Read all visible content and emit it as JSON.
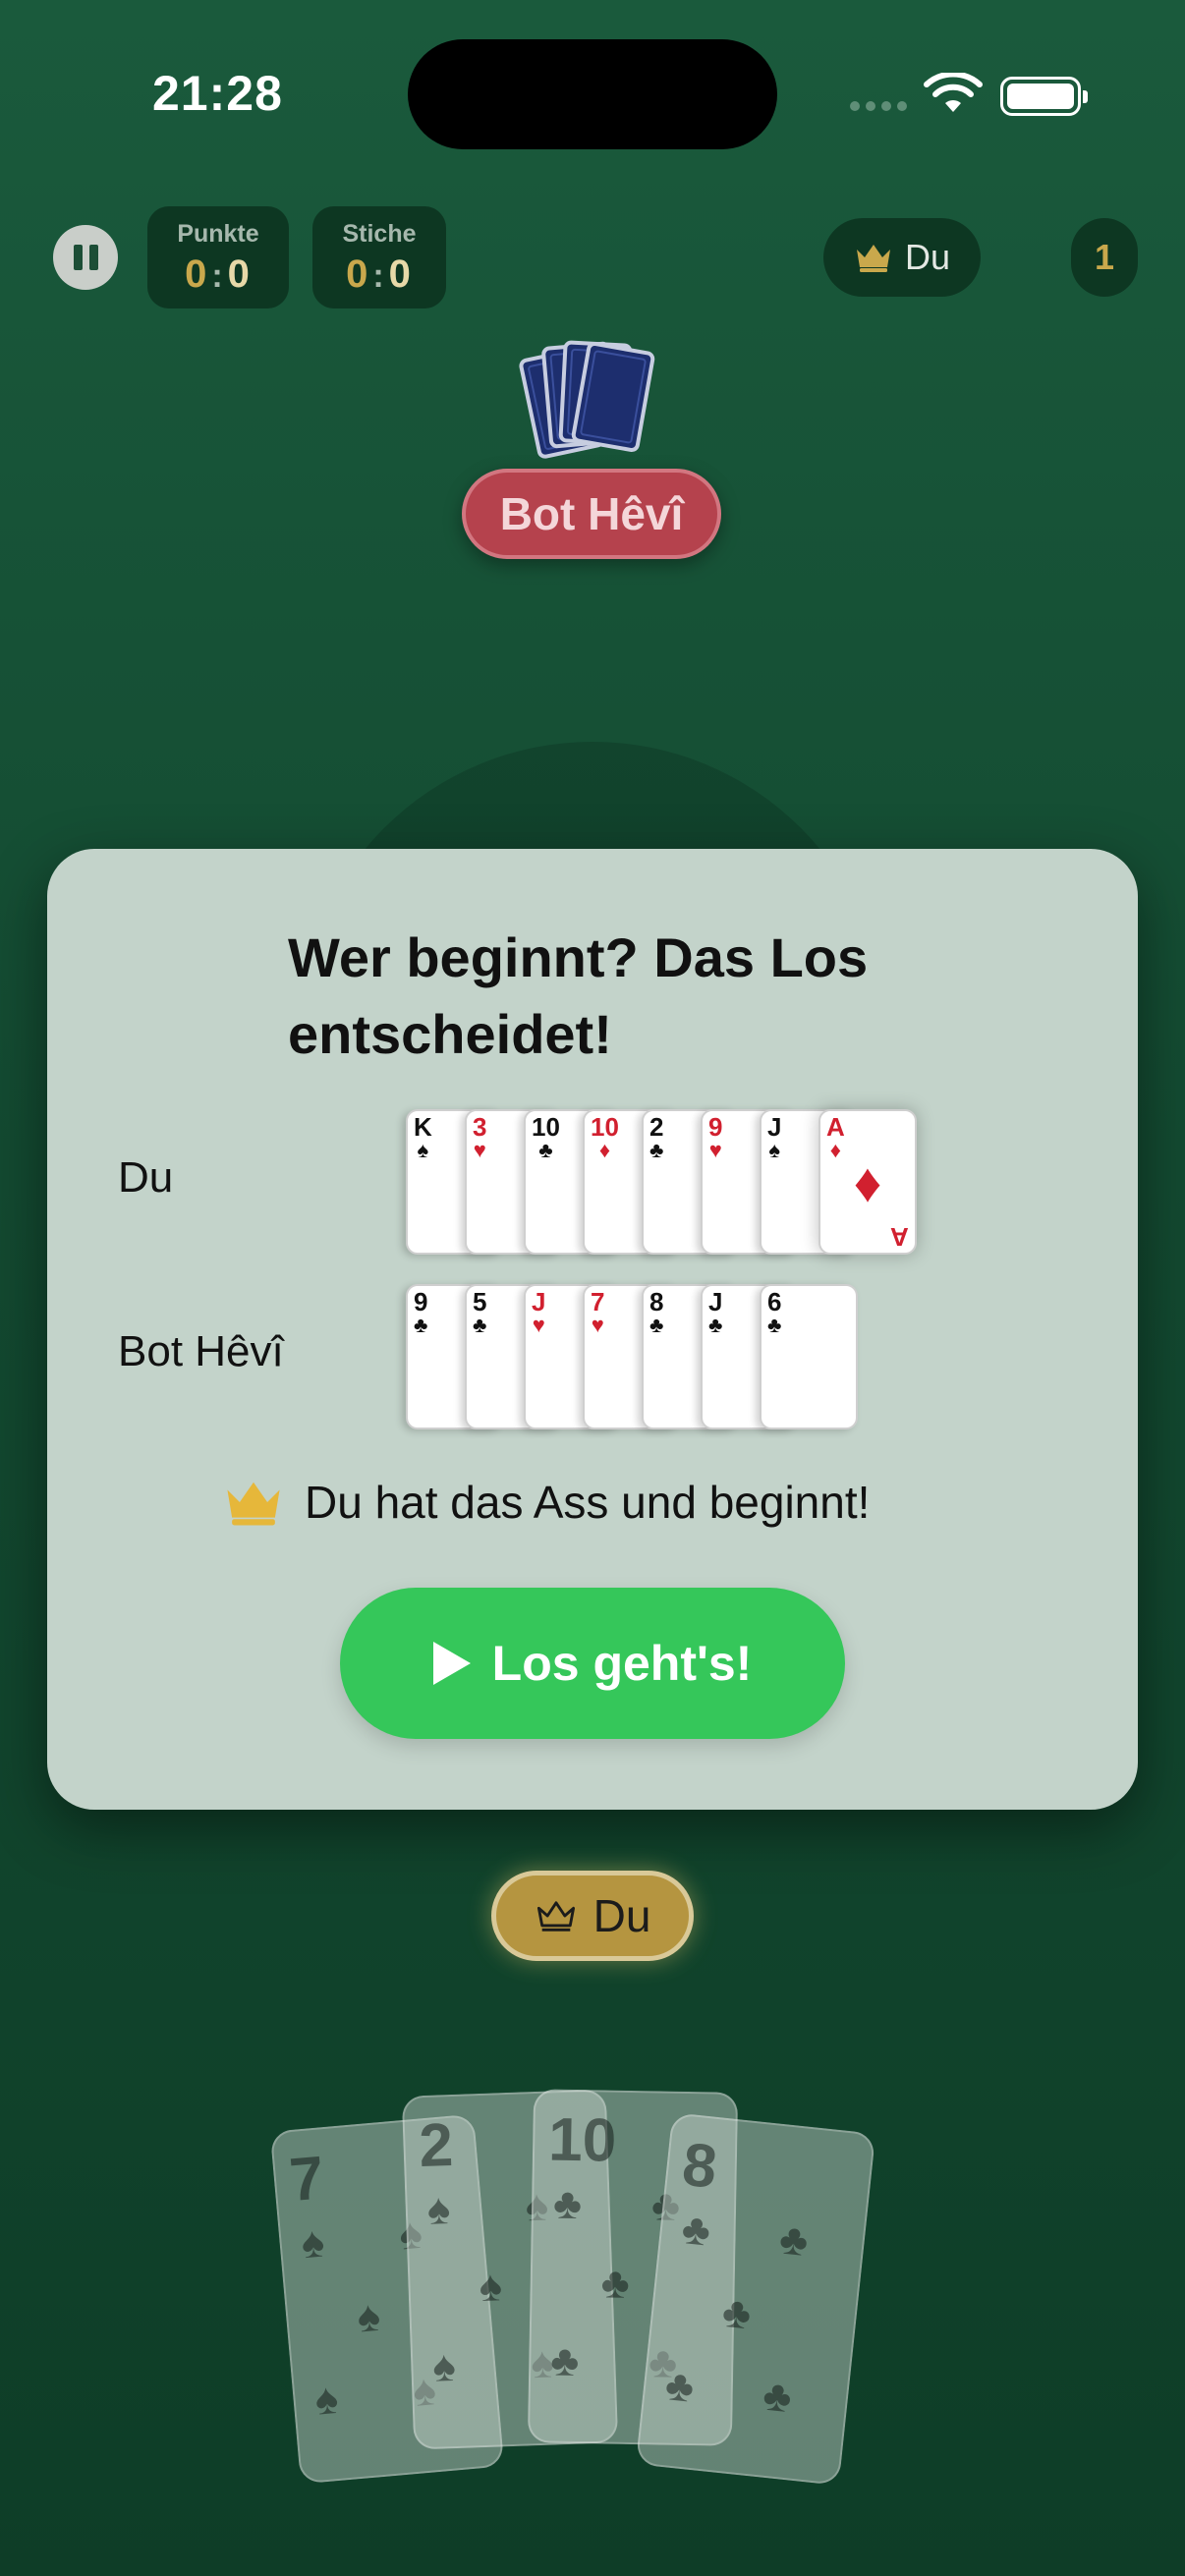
{
  "status_bar": {
    "time": "21:28"
  },
  "hud": {
    "points": {
      "label": "Punkte",
      "you": "0",
      "sep": ":",
      "opp": "0"
    },
    "tricks": {
      "label": "Stiche",
      "you": "0",
      "sep": ":",
      "opp": "0"
    },
    "current_player": "Du",
    "round": "1"
  },
  "opponent": {
    "name": "Bot Hêvî"
  },
  "modal": {
    "title": "Wer beginnt? Das Los entscheidet!",
    "you_label": "Du",
    "bot_label": "Bot Hêvî",
    "you_cards": [
      {
        "rank": "K",
        "suit": "♠",
        "color": "blk"
      },
      {
        "rank": "3",
        "suit": "♥",
        "color": "red"
      },
      {
        "rank": "10",
        "suit": "♣",
        "color": "blk"
      },
      {
        "rank": "10",
        "suit": "♦",
        "color": "red"
      },
      {
        "rank": "2",
        "suit": "♣",
        "color": "blk"
      },
      {
        "rank": "9",
        "suit": "♥",
        "color": "red"
      },
      {
        "rank": "J",
        "suit": "♠",
        "color": "blk"
      },
      {
        "rank": "A",
        "suit": "♦",
        "color": "red"
      }
    ],
    "bot_cards": [
      {
        "rank": "9",
        "suit": "♣",
        "color": "blk"
      },
      {
        "rank": "5",
        "suit": "♣",
        "color": "blk"
      },
      {
        "rank": "J",
        "suit": "♥",
        "color": "red"
      },
      {
        "rank": "7",
        "suit": "♥",
        "color": "red"
      },
      {
        "rank": "8",
        "suit": "♣",
        "color": "blk"
      },
      {
        "rank": "J",
        "suit": "♣",
        "color": "blk"
      },
      {
        "rank": "6",
        "suit": "♣",
        "color": "blk"
      }
    ],
    "result": "Du hat das Ass und beginnt!",
    "start_button": "Los geht's!"
  },
  "player": {
    "name": "Du",
    "hand": [
      {
        "rank": "7",
        "suit": "♠"
      },
      {
        "rank": "2",
        "suit": "♠"
      },
      {
        "rank": "10",
        "suit": "♣"
      },
      {
        "rank": "8",
        "suit": "♣"
      }
    ]
  },
  "colors": {
    "felt": "#134a31",
    "gold": "#c9a84c",
    "opponent_red": "#b5424d",
    "button_green": "#35c75a"
  },
  "icons": [
    "pause-icon",
    "crown-icon",
    "play-icon",
    "wifi-icon",
    "battery-icon"
  ]
}
